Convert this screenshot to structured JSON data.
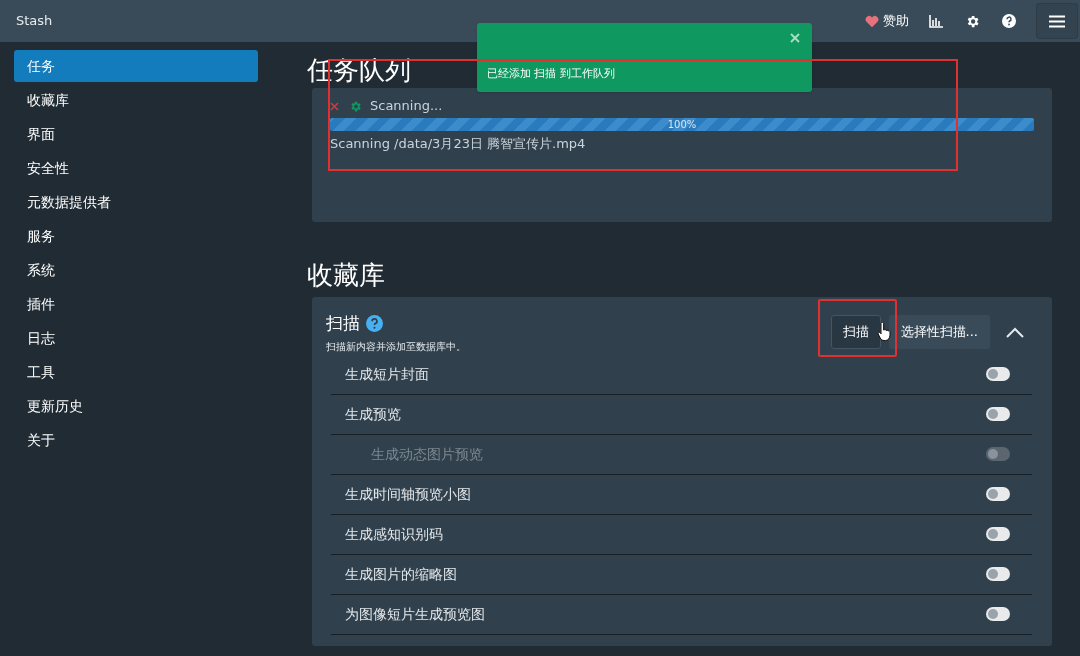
{
  "header": {
    "brand": "Stash",
    "donate": "赞助"
  },
  "sidebar": {
    "items": [
      {
        "label": "任务",
        "selected": true
      },
      {
        "label": "收藏库",
        "selected": false
      },
      {
        "label": "界面",
        "selected": false
      },
      {
        "label": "安全性",
        "selected": false
      },
      {
        "label": "元数据提供者",
        "selected": false
      },
      {
        "label": "服务",
        "selected": false
      },
      {
        "label": "系统",
        "selected": false
      },
      {
        "label": "插件",
        "selected": false
      },
      {
        "label": "日志",
        "selected": false
      },
      {
        "label": "工具",
        "selected": false
      },
      {
        "label": "更新历史",
        "selected": false
      },
      {
        "label": "关于",
        "selected": false
      }
    ]
  },
  "toast": {
    "message": "已经添加 扫描 到工作队列"
  },
  "queue": {
    "title": "任务队列",
    "job": {
      "status": "Scanning...",
      "level": 1,
      "reading": "100%",
      "detail": "Scanning /data/3月23日 腾智宣传片.mp4"
    }
  },
  "library": {
    "title": "收藏库",
    "scan": {
      "title": "扫描",
      "description": "扫描新内容并添加至数据库中。",
      "buttons": [
        "扫描",
        "选择性扫描..."
      ],
      "expanded": true,
      "options": [
        {
          "label": "生成短片封面",
          "on": false,
          "disabled": false
        },
        {
          "label": "生成预览",
          "on": false,
          "disabled": false,
          "children": [
            {
              "label": "生成动态图片预览",
              "on": false,
              "disabled": true
            }
          ]
        },
        {
          "label": "生成时间轴预览小图",
          "on": false,
          "disabled": false
        },
        {
          "label": "生成感知识别码",
          "on": false,
          "disabled": false
        },
        {
          "label": "生成图片的缩略图",
          "on": false,
          "disabled": false
        },
        {
          "label": "为图像短片生成预览图",
          "on": false,
          "disabled": false
        }
      ]
    }
  }
}
